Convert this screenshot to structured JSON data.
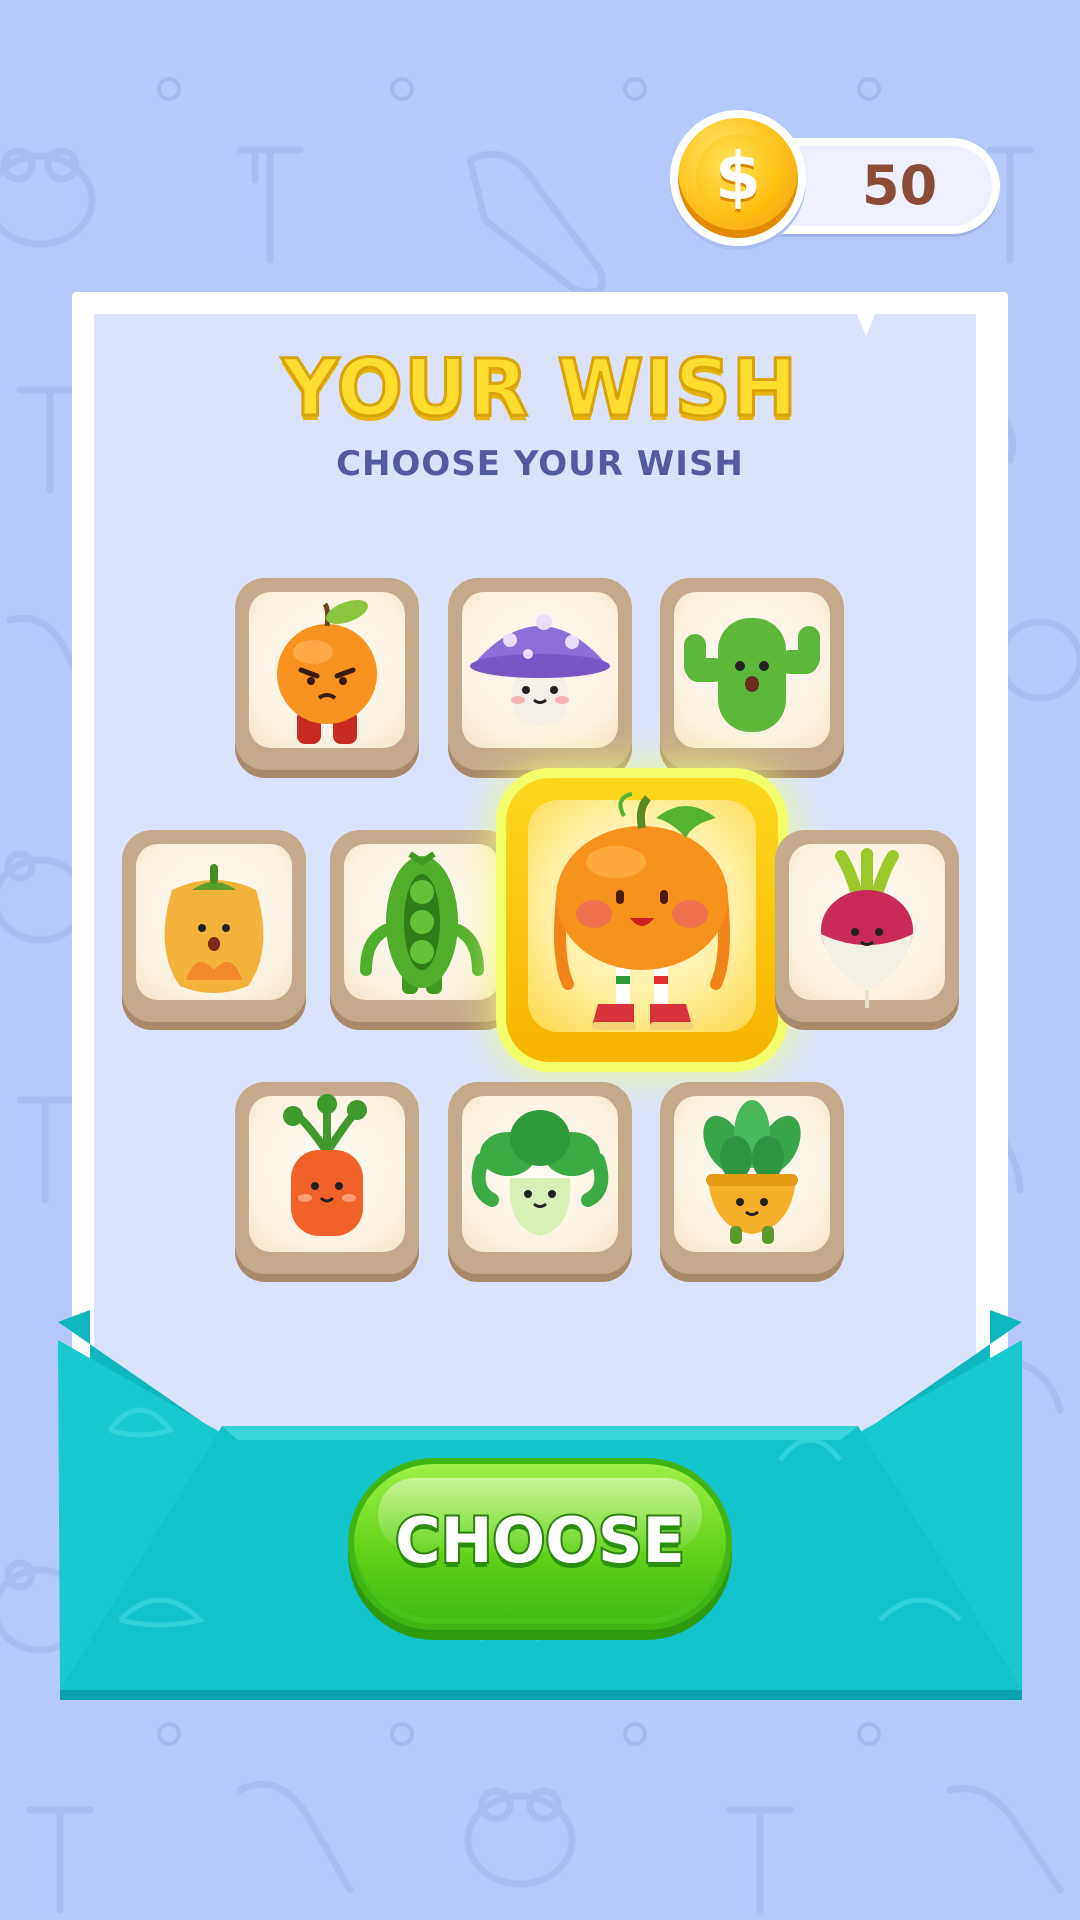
{
  "header": {
    "coin_icon": "dollar-coin-icon",
    "coin_glyph": "$",
    "coins": "50"
  },
  "panel": {
    "title": "YOUR WISH",
    "subtitle": "CHOOSE YOUR WISH"
  },
  "wishes": [
    {
      "name": "angry-orange-character-icon",
      "selected": false
    },
    {
      "name": "mushroom-character-icon",
      "selected": false
    },
    {
      "name": "cactus-character-icon",
      "selected": false
    },
    {
      "name": "yellow-pepper-character-icon",
      "selected": false
    },
    {
      "name": "pea-pod-character-icon",
      "selected": false
    },
    {
      "name": "pumpkin-character-icon",
      "selected": true
    },
    {
      "name": "radish-character-icon",
      "selected": false
    },
    {
      "name": "carrot-character-icon",
      "selected": false
    },
    {
      "name": "bok-choy-character-icon",
      "selected": false
    },
    {
      "name": "succulent-pot-character-icon",
      "selected": false
    }
  ],
  "footer": {
    "choose_label": "CHOOSE"
  },
  "colors": {
    "background": "#b6c9fb",
    "title_yellow": "#ffdd2e",
    "subtitle_purple": "#545aa0",
    "button_green": "#62d31a",
    "envelope_teal": "#13c3cc",
    "coin_text": "#8a4c36"
  }
}
